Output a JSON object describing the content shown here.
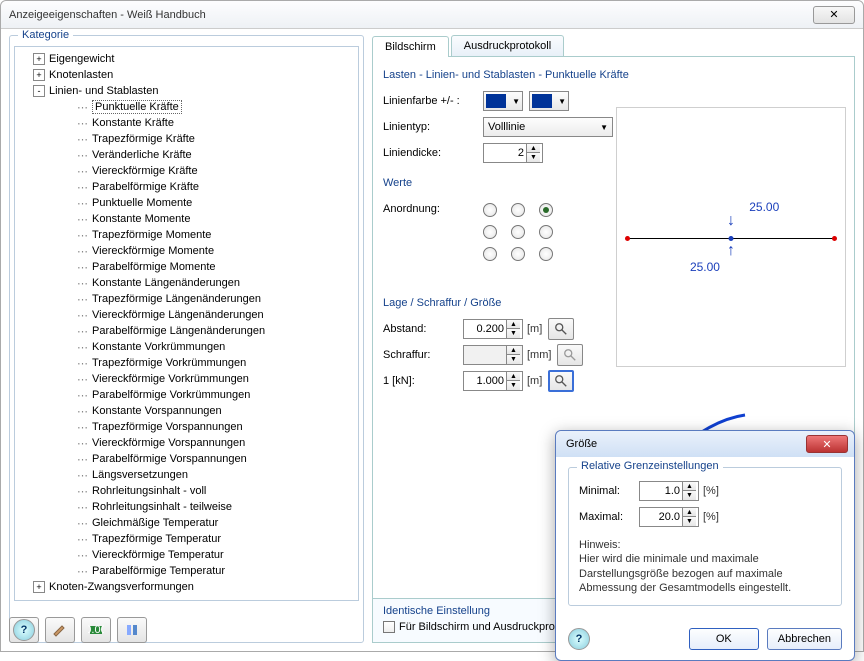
{
  "window": {
    "title": "Anzeigeeigenschaften - Weiß Handbuch",
    "close_glyph": "✕"
  },
  "left": {
    "fieldset_label": "Kategorie",
    "items": [
      {
        "l": 1,
        "toggle": "+",
        "label": "Eigengewicht"
      },
      {
        "l": 1,
        "toggle": "+",
        "label": "Knotenlasten"
      },
      {
        "l": 1,
        "toggle": "-",
        "label": "Linien- und Stablasten"
      },
      {
        "l": 3,
        "label": "Punktuelle Kräfte",
        "selected": true
      },
      {
        "l": 3,
        "label": "Konstante Kräfte"
      },
      {
        "l": 3,
        "label": "Trapezförmige Kräfte"
      },
      {
        "l": 3,
        "label": "Veränderliche Kräfte"
      },
      {
        "l": 3,
        "label": "Viereckförmige Kräfte"
      },
      {
        "l": 3,
        "label": "Parabelförmige Kräfte"
      },
      {
        "l": 3,
        "label": "Punktuelle Momente"
      },
      {
        "l": 3,
        "label": "Konstante Momente"
      },
      {
        "l": 3,
        "label": "Trapezförmige Momente"
      },
      {
        "l": 3,
        "label": "Viereckförmige Momente"
      },
      {
        "l": 3,
        "label": "Parabelförmige Momente"
      },
      {
        "l": 3,
        "label": "Konstante Längenänderungen"
      },
      {
        "l": 3,
        "label": "Trapezförmige Längenänderungen"
      },
      {
        "l": 3,
        "label": "Viereckförmige Längenänderungen"
      },
      {
        "l": 3,
        "label": "Parabelförmige Längenänderungen"
      },
      {
        "l": 3,
        "label": "Konstante Vorkrümmungen"
      },
      {
        "l": 3,
        "label": "Trapezförmige Vorkrümmungen"
      },
      {
        "l": 3,
        "label": "Viereckförmige Vorkrümmungen"
      },
      {
        "l": 3,
        "label": "Parabelförmige Vorkrümmungen"
      },
      {
        "l": 3,
        "label": "Konstante Vorspannungen"
      },
      {
        "l": 3,
        "label": "Trapezförmige Vorspannungen"
      },
      {
        "l": 3,
        "label": "Viereckförmige Vorspannungen"
      },
      {
        "l": 3,
        "label": "Parabelförmige Vorspannungen"
      },
      {
        "l": 3,
        "label": "Längsversetzungen"
      },
      {
        "l": 3,
        "label": "Rohrleitungsinhalt - voll"
      },
      {
        "l": 3,
        "label": "Rohrleitungsinhalt - teilweise"
      },
      {
        "l": 3,
        "label": "Gleichmäßige Temperatur"
      },
      {
        "l": 3,
        "label": "Trapezförmige Temperatur"
      },
      {
        "l": 3,
        "label": "Viereckförmige Temperatur"
      },
      {
        "l": 3,
        "label": "Parabelförmige Temperatur"
      },
      {
        "l": 1,
        "toggle": "+",
        "label": "Knoten-Zwangsverformungen"
      }
    ]
  },
  "tabs": {
    "screen": "Bildschirm",
    "print": "Ausdruckprotokoll"
  },
  "section": {
    "title": "Lasten - Linien- und Stablasten - Punktuelle Kräfte",
    "line_color_label": "Linienfarbe +/- :",
    "line_type_label": "Linientyp:",
    "line_type_value": "Volllinie",
    "line_thickness_label": "Liniendicke:",
    "line_thickness_value": "2",
    "werte_label": "Werte",
    "anordnung_label": "Anordnung:",
    "lage_label": "Lage / Schraffur / Größe",
    "abstand_label": "Abstand:",
    "abstand_value": "0.200",
    "abstand_unit": "[m]",
    "schraffur_label": "Schraffur:",
    "schraffur_value": "",
    "schraffur_unit": "[mm]",
    "kn_label": "1  [kN]:",
    "kn_value": "1.000",
    "kn_unit": "[m]"
  },
  "preview": {
    "value_top": "25.00",
    "value_bottom": "25.00"
  },
  "identical": {
    "header": "Identische Einstellung",
    "checkbox_label": "Für Bildschirm und Ausdruckproto"
  },
  "subdialog": {
    "title": "Größe",
    "fieldset": "Relative Grenzeinstellungen",
    "min_label": "Minimal:",
    "min_value": "1.0",
    "min_unit": "[%]",
    "max_label": "Maximal:",
    "max_value": "20.0",
    "max_unit": "[%]",
    "hint_label": "Hinweis:",
    "hint_text": "Hier wird die minimale und maximale Darstellungsgröße bezogen auf maximale Abmessung der Gesamtmodells eingestellt.",
    "ok": "OK",
    "cancel": "Abbrechen",
    "close_glyph": "✕"
  },
  "help_glyph": "?"
}
